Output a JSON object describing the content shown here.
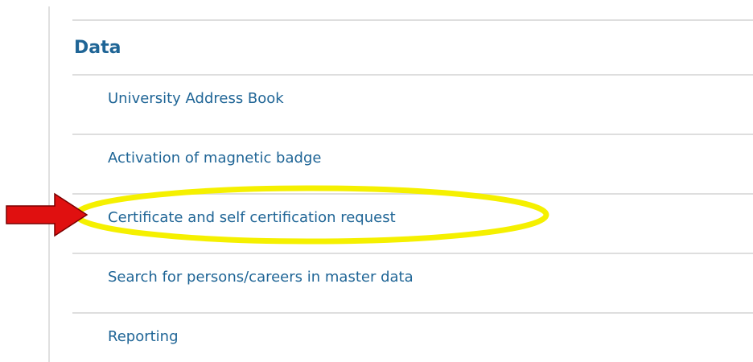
{
  "section": {
    "title": "Data"
  },
  "menu": {
    "items": [
      {
        "label": "University Address Book"
      },
      {
        "label": "Activation of magnetic badge"
      },
      {
        "label": "Certificate and self certification request"
      },
      {
        "label": "Search for persons/careers in master data"
      },
      {
        "label": "Reporting"
      }
    ]
  },
  "annotation": {
    "arrow_icon": "right-arrow-icon",
    "highlight_shape": "ellipse",
    "arrow_color": "#e01010",
    "highlight_color": "#f5f000",
    "highlighted_item": "Certificate and self certification request"
  },
  "colors": {
    "link": "#1f6596",
    "divider": "#dedede"
  }
}
